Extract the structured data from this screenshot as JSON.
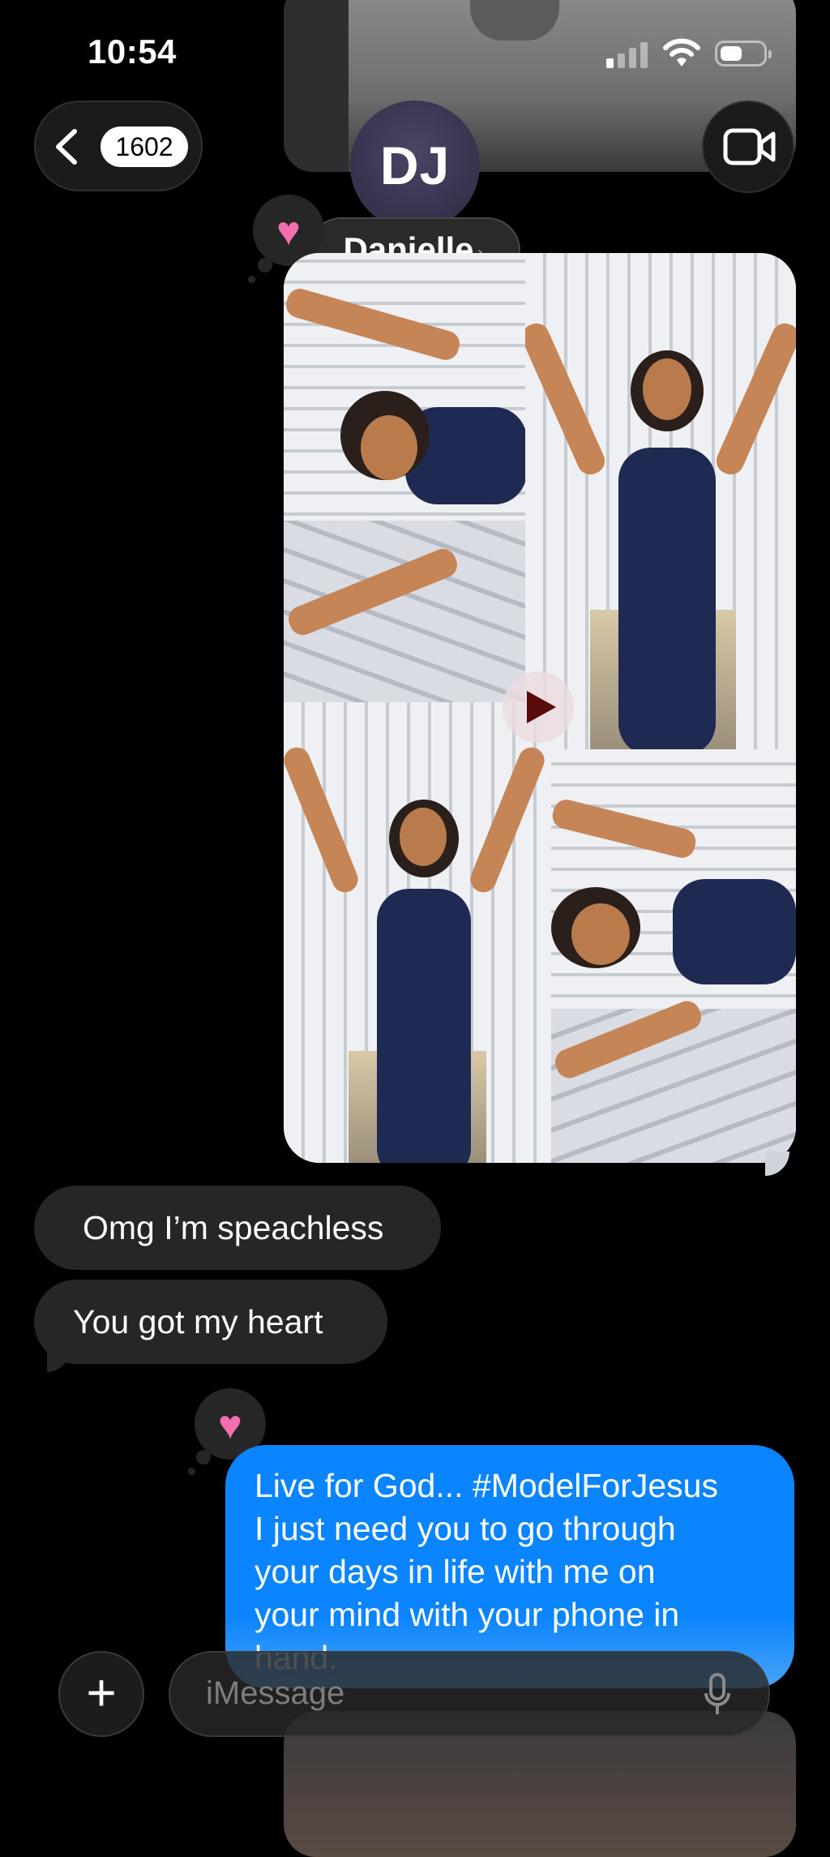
{
  "status_bar": {
    "time": "10:54"
  },
  "nav": {
    "unread_count": "1602",
    "avatar_initials": "DJ",
    "contact_name": "Danielle",
    "contact_chevron": "›"
  },
  "icons": {
    "back": "chevron-left-icon",
    "facetime": "video-camera-icon",
    "heart": "heart-icon",
    "play": "play-icon",
    "add": "plus-icon",
    "mic": "microphone-icon"
  },
  "tapbacks": {
    "heart_glyph": "♥"
  },
  "messages": {
    "incoming": [
      "Omg I’m speachless",
      "You got my heart"
    ],
    "outgoing_lines": [
      "Live for God... #ModelForJesus",
      "I just need you to go through",
      "your days in life with me on",
      "your mind with your phone in",
      "hand."
    ]
  },
  "composer": {
    "add_label": "+",
    "placeholder": "iMessage"
  },
  "colors": {
    "background": "#000000",
    "incoming_bubble": "#262626",
    "outgoing_bubble": "#0A84FF",
    "heart": "#F36FB0"
  }
}
